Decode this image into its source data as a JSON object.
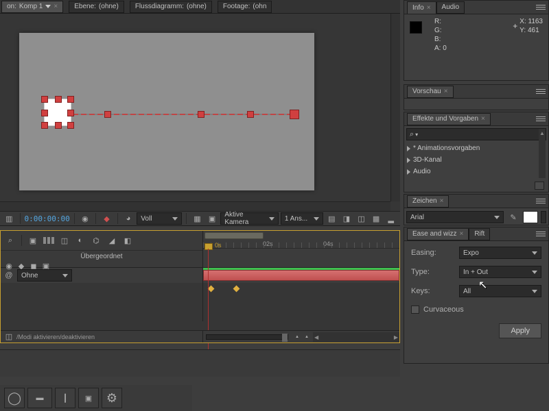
{
  "topTabs": {
    "comp": {
      "prefix": "on:",
      "name": "Komp 1"
    },
    "layer": {
      "prefix": "Ebene:",
      "value": "(ohne)"
    },
    "flowchart": {
      "prefix": "Flussdiagramm:",
      "value": "(ohne)"
    },
    "footage": {
      "prefix": "Footage:",
      "value": "(ohn"
    }
  },
  "info": {
    "tabs": [
      "Info",
      "Audio"
    ],
    "r": "R:",
    "g": "G:",
    "b": "B:",
    "a": "A:",
    "aVal": "0",
    "xLabel": "X",
    "xVal": ": 1163",
    "yLabel": "Y",
    "yVal": ": 461"
  },
  "preview": {
    "title": "Vorschau"
  },
  "effects": {
    "title": "Effekte und Vorgaben",
    "searchGlyph": "⌕",
    "searchTail": "▾",
    "items": [
      "* Animationsvorgaben",
      "3D-Kanal",
      "Audio"
    ]
  },
  "character": {
    "title": "Zeichen",
    "font": "Arial"
  },
  "easeWizz": {
    "tab1": "Ease and wizz",
    "tab2": "Rift",
    "easingLabel": "Easing:",
    "easingValue": "Expo",
    "typeLabel": "Type:",
    "typeValue": "In + Out",
    "keysLabel": "Keys:",
    "keysValue": "All",
    "curvaceous": "Curvaceous",
    "apply": "Apply"
  },
  "viewerBar": {
    "timecode": "0:00:00:00",
    "preset": "Voll",
    "camera": "Aktive Kamera",
    "views": "1 Ans..."
  },
  "timeline": {
    "parent": "Übergeordnet",
    "parentVal": "Ohne",
    "t0s": "0s",
    "t2s": "02s",
    "t4s": "04s",
    "footer": "/Modi aktivieren/deaktivieren"
  },
  "colors": {
    "swatch": "#ffffff"
  }
}
